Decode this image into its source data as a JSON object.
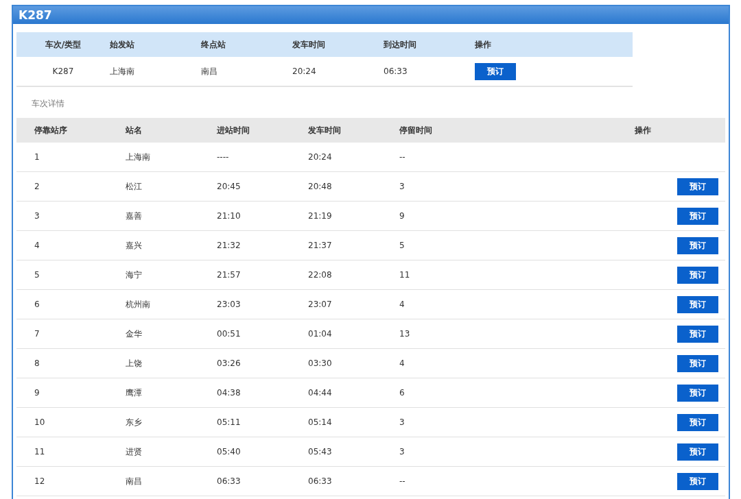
{
  "panel": {
    "title": "K287"
  },
  "summary": {
    "columns": [
      "车次/类型",
      "始发站",
      "终点站",
      "发车时间",
      "到达时间",
      "操作"
    ],
    "row": {
      "train": "K287",
      "from": "上海南",
      "to": "南昌",
      "depart": "20:24",
      "arrive": "06:33",
      "button": "预订"
    }
  },
  "details_label": "车次详情",
  "stops": {
    "columns": [
      "停靠站序",
      "站名",
      "进站时间",
      "发车时间",
      "停留时间",
      "操作"
    ],
    "rows": [
      {
        "seq": "1",
        "station": "上海南",
        "arrive": "----",
        "depart": "20:24",
        "stay": "--"
      },
      {
        "seq": "2",
        "station": "松江",
        "arrive": "20:45",
        "depart": "20:48",
        "stay": "3",
        "button": "预订"
      },
      {
        "seq": "3",
        "station": "嘉善",
        "arrive": "21:10",
        "depart": "21:19",
        "stay": "9",
        "button": "预订"
      },
      {
        "seq": "4",
        "station": "嘉兴",
        "arrive": "21:32",
        "depart": "21:37",
        "stay": "5",
        "button": "预订"
      },
      {
        "seq": "5",
        "station": "海宁",
        "arrive": "21:57",
        "depart": "22:08",
        "stay": "11",
        "button": "预订"
      },
      {
        "seq": "6",
        "station": "杭州南",
        "arrive": "23:03",
        "depart": "23:07",
        "stay": "4",
        "button": "预订"
      },
      {
        "seq": "7",
        "station": "金华",
        "arrive": "00:51",
        "depart": "01:04",
        "stay": "13",
        "button": "预订"
      },
      {
        "seq": "8",
        "station": "上饶",
        "arrive": "03:26",
        "depart": "03:30",
        "stay": "4",
        "button": "预订"
      },
      {
        "seq": "9",
        "station": "鹰潭",
        "arrive": "04:38",
        "depart": "04:44",
        "stay": "6",
        "button": "预订"
      },
      {
        "seq": "10",
        "station": "东乡",
        "arrive": "05:11",
        "depart": "05:14",
        "stay": "3",
        "button": "预订"
      },
      {
        "seq": "11",
        "station": "进贤",
        "arrive": "05:40",
        "depart": "05:43",
        "stay": "3",
        "button": "预订"
      },
      {
        "seq": "12",
        "station": "南昌",
        "arrive": "06:33",
        "depart": "06:33",
        "stay": "--",
        "button": "预订"
      }
    ]
  }
}
